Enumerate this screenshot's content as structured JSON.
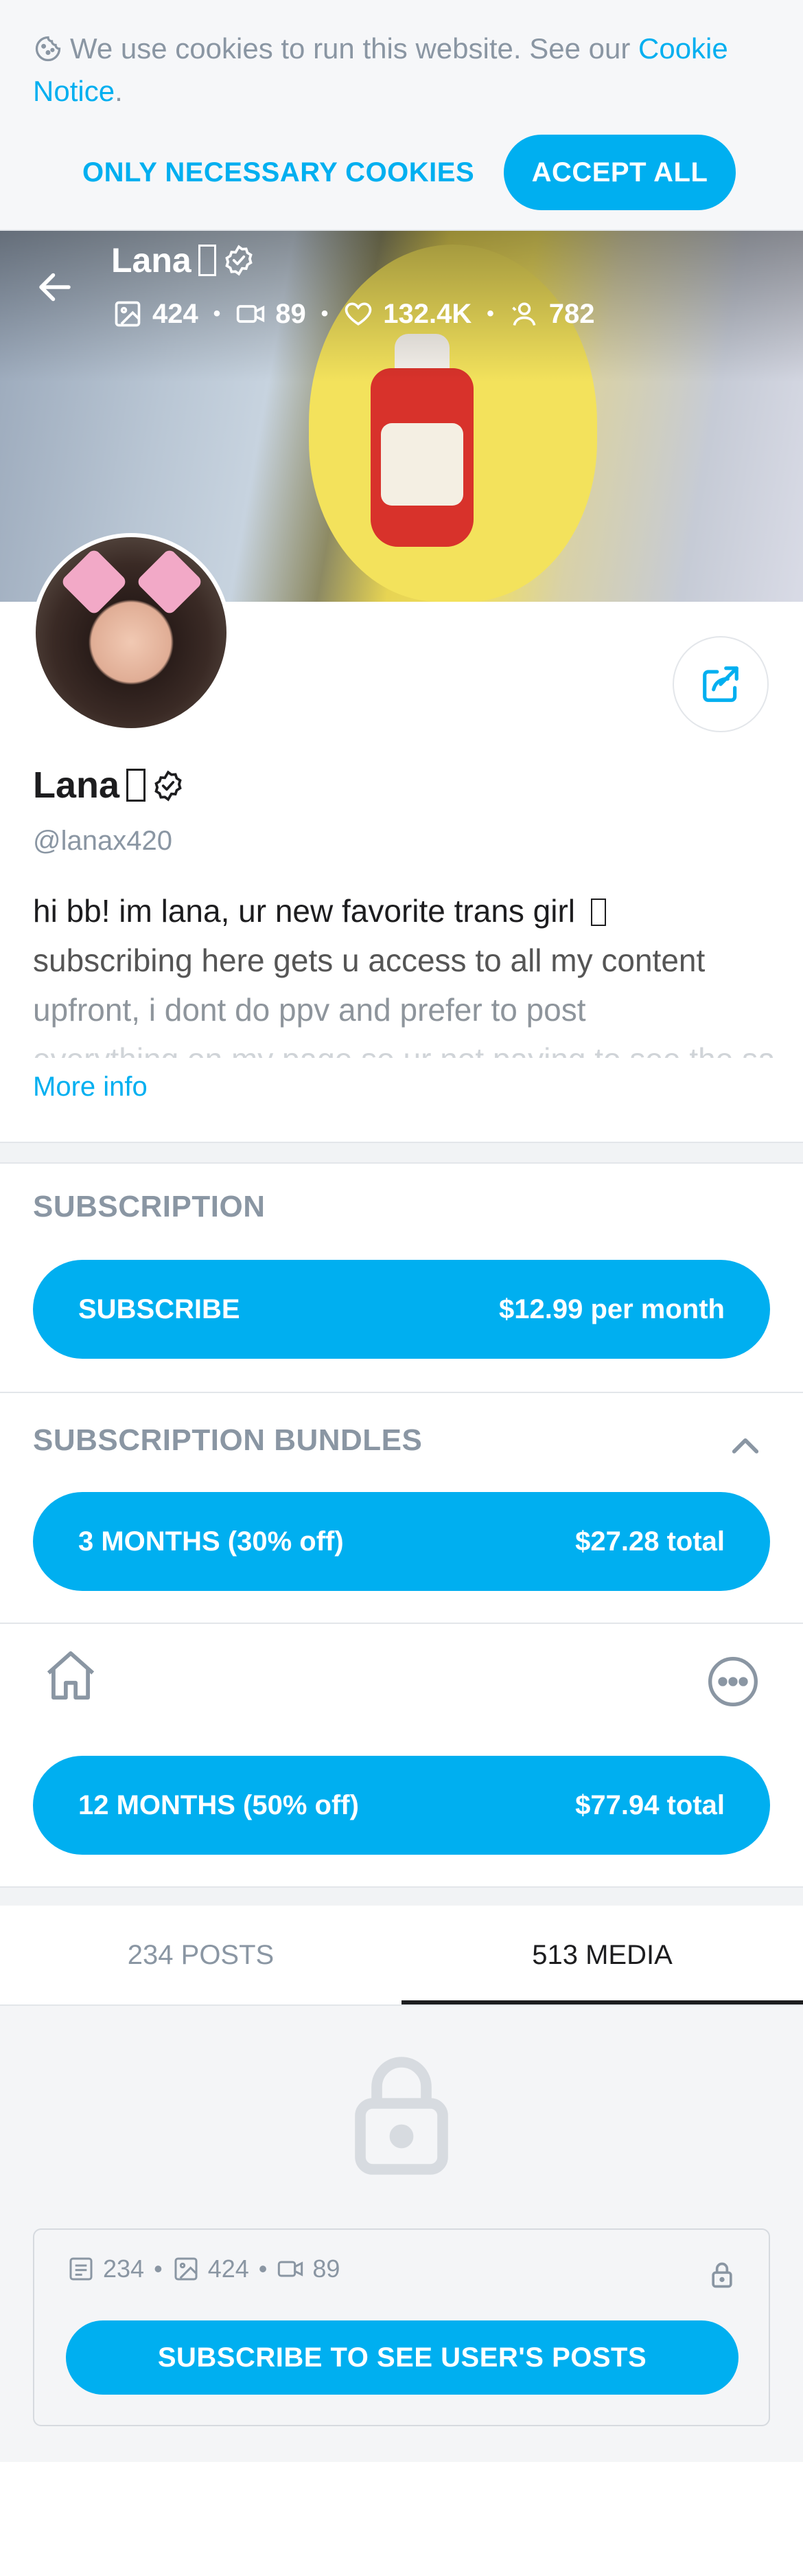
{
  "cookie_banner": {
    "text": "We use cookies to run this website. See our",
    "link_text": "Cookie Notice",
    "suffix": ".",
    "necessary_button": "ONLY NECESSARY COOKIES",
    "accept_button": "ACCEPT ALL",
    "icon": "cookie-icon"
  },
  "header": {
    "name": "Lana",
    "stats": {
      "images": "424",
      "videos": "89",
      "likes": "132.4K",
      "subscribers": "782"
    },
    "back_icon": "arrow-left-icon"
  },
  "profile": {
    "name": "Lana",
    "handle": "@lanax420",
    "bio_lines": [
      "hi bb! im lana, ur new favorite trans girl",
      "subscribing here gets u access to all my content",
      "upfront, i dont do ppv and prefer to post",
      "everything on my page so ur not paying to see the same"
    ],
    "more_info": "More info",
    "share_icon": "share-icon"
  },
  "subscription": {
    "title": "SUBSCRIPTION",
    "subscribe_label": "SUBSCRIBE",
    "subscribe_price": "$12.99 per month"
  },
  "bundles": {
    "title": "SUBSCRIPTION BUNDLES",
    "items": [
      {
        "label": "3 MONTHS (30% off)",
        "price": "$27.28 total"
      },
      {
        "label": "12 MONTHS (50% off)",
        "price": "$77.94 total"
      }
    ]
  },
  "tabs": [
    {
      "label": "234 POSTS",
      "active": false
    },
    {
      "label": "513 MEDIA",
      "active": true
    }
  ],
  "locked_card": {
    "posts": "234",
    "images": "424",
    "videos": "89",
    "button": "SUBSCRIBE TO SEE USER'S POSTS"
  },
  "colors": {
    "accent": "#00aff0",
    "muted": "#8a96a3",
    "text": "#1d1d1f"
  }
}
